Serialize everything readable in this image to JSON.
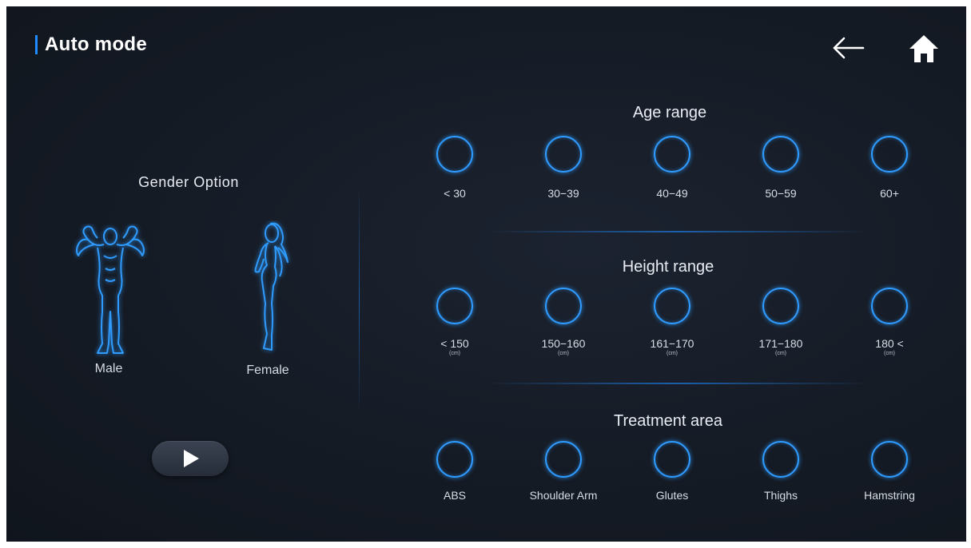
{
  "header": {
    "title": "Auto mode",
    "back_icon": "arrow-left-icon",
    "home_icon": "home-icon"
  },
  "gender": {
    "title": "Gender Option",
    "options": [
      {
        "label": "Male",
        "icon": "male-body-icon"
      },
      {
        "label": "Female",
        "icon": "female-body-icon"
      }
    ],
    "play_icon": "play-icon"
  },
  "age": {
    "title": "Age range",
    "options": [
      {
        "label": "< 30"
      },
      {
        "label": "30−39"
      },
      {
        "label": "40−49"
      },
      {
        "label": "50−59"
      },
      {
        "label": "60+"
      }
    ]
  },
  "height": {
    "title": "Height range",
    "options": [
      {
        "label": "< 150",
        "unit": "(cm)"
      },
      {
        "label": "150−160",
        "unit": "(cm)"
      },
      {
        "label": "161−170",
        "unit": "(cm)"
      },
      {
        "label": "171−180",
        "unit": "(cm)"
      },
      {
        "label": "180 <",
        "unit": "(cm)"
      }
    ]
  },
  "treatment": {
    "title": "Treatment area",
    "options": [
      {
        "label": "ABS"
      },
      {
        "label": "Shoulder Arm"
      },
      {
        "label": "Glutes"
      },
      {
        "label": "Thighs"
      },
      {
        "label": "Hamstring"
      }
    ]
  },
  "colors": {
    "accent": "#1e8cff",
    "ring": "#2f9bff",
    "background": "#151b25",
    "text": "#ffffff"
  }
}
